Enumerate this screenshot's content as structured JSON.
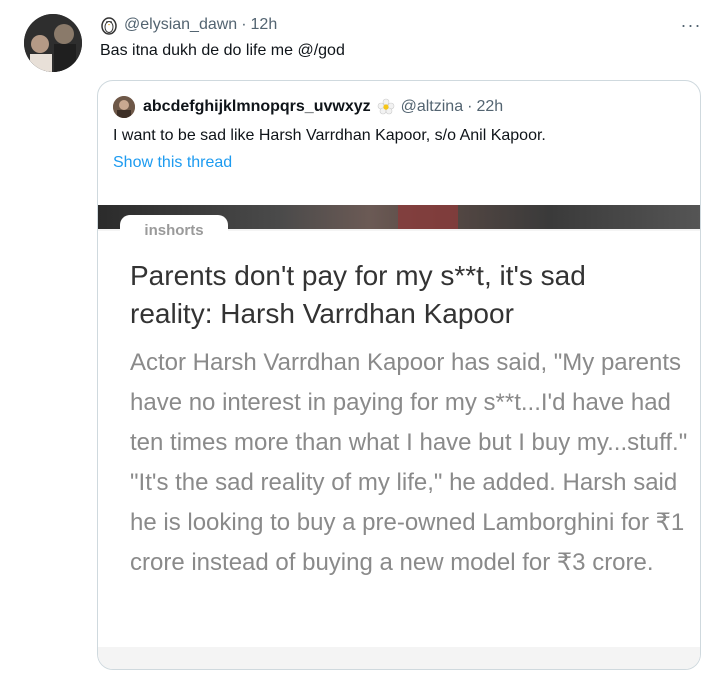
{
  "tweet": {
    "handle": "@elysian_dawn",
    "separator": "·",
    "time": "12h",
    "text": "Bas itna dukh de do life me @/god",
    "more_icon": "more-horizontal-icon",
    "more_label": "···"
  },
  "quoted": {
    "display_name": "abcdefghijklmnopqrs_uvwxyz",
    "handle": "@altzina",
    "separator": "·",
    "time": "22h",
    "text": "I want to be sad like Harsh Varrdhan Kapoor, s/o Anil Kapoor.",
    "show_thread_label": "Show this thread",
    "media": {
      "source_label": "inshorts",
      "headline": "Parents don't pay for my s**t, it's sad reality: Harsh Varrdhan Kapoor",
      "body": "Actor Harsh Varrdhan Kapoor has said, \"My parents have no interest in paying for my s**t...I'd have had ten times more than what I have but I buy my...stuff.\" \"It's the sad reality of my life,\" he added. Harsh said he is looking to buy a pre-owned Lamborghini for ₹1 crore instead of buying a new model for ₹3 crore."
    }
  },
  "colors": {
    "link_blue": "#1d9bf0",
    "muted_gray": "#536471",
    "border": "#cfd9de"
  }
}
